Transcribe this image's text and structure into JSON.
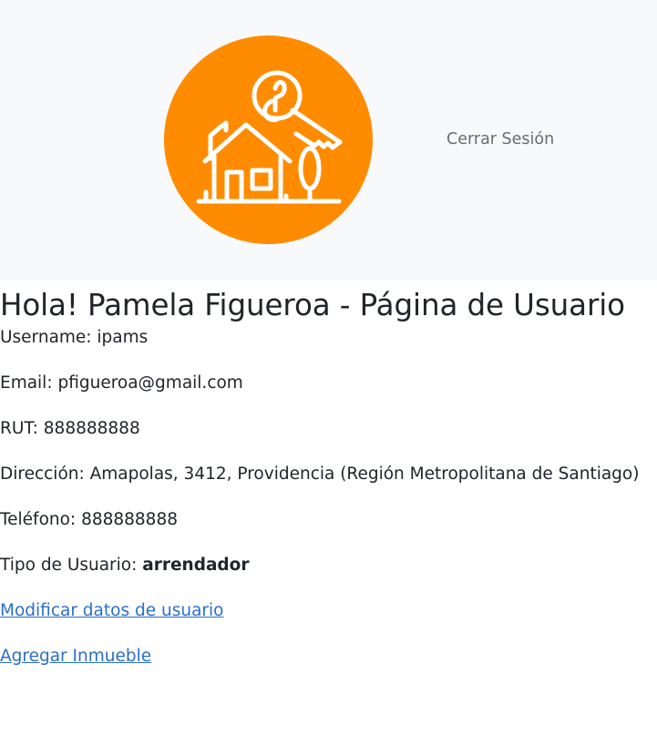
{
  "navbar": {
    "logo_icon": "house-key-icon",
    "logout_label": "Cerrar Sesión",
    "colors": {
      "logo_bg": "#ff8c00",
      "navbar_bg": "#f8f9fa"
    }
  },
  "page": {
    "title": "Hola! Pamela Figueroa - Página de Usuario"
  },
  "user": {
    "username_label": "Username: ",
    "username": "ipams",
    "email_label": "Email: ",
    "email": "pfigueroa@gmail.com",
    "rut_label": "RUT: ",
    "rut": "888888888",
    "address_label": "Dirección: ",
    "address": "Amapolas, 3412, Providencia (Región Metropolitana de Santiago)",
    "phone_label": "Teléfono: ",
    "phone": "888888888",
    "type_label": "Tipo de Usuario: ",
    "type": "arrendador"
  },
  "links": {
    "edit_user": "Modificar datos de usuario",
    "add_property": "Agregar Inmueble"
  }
}
